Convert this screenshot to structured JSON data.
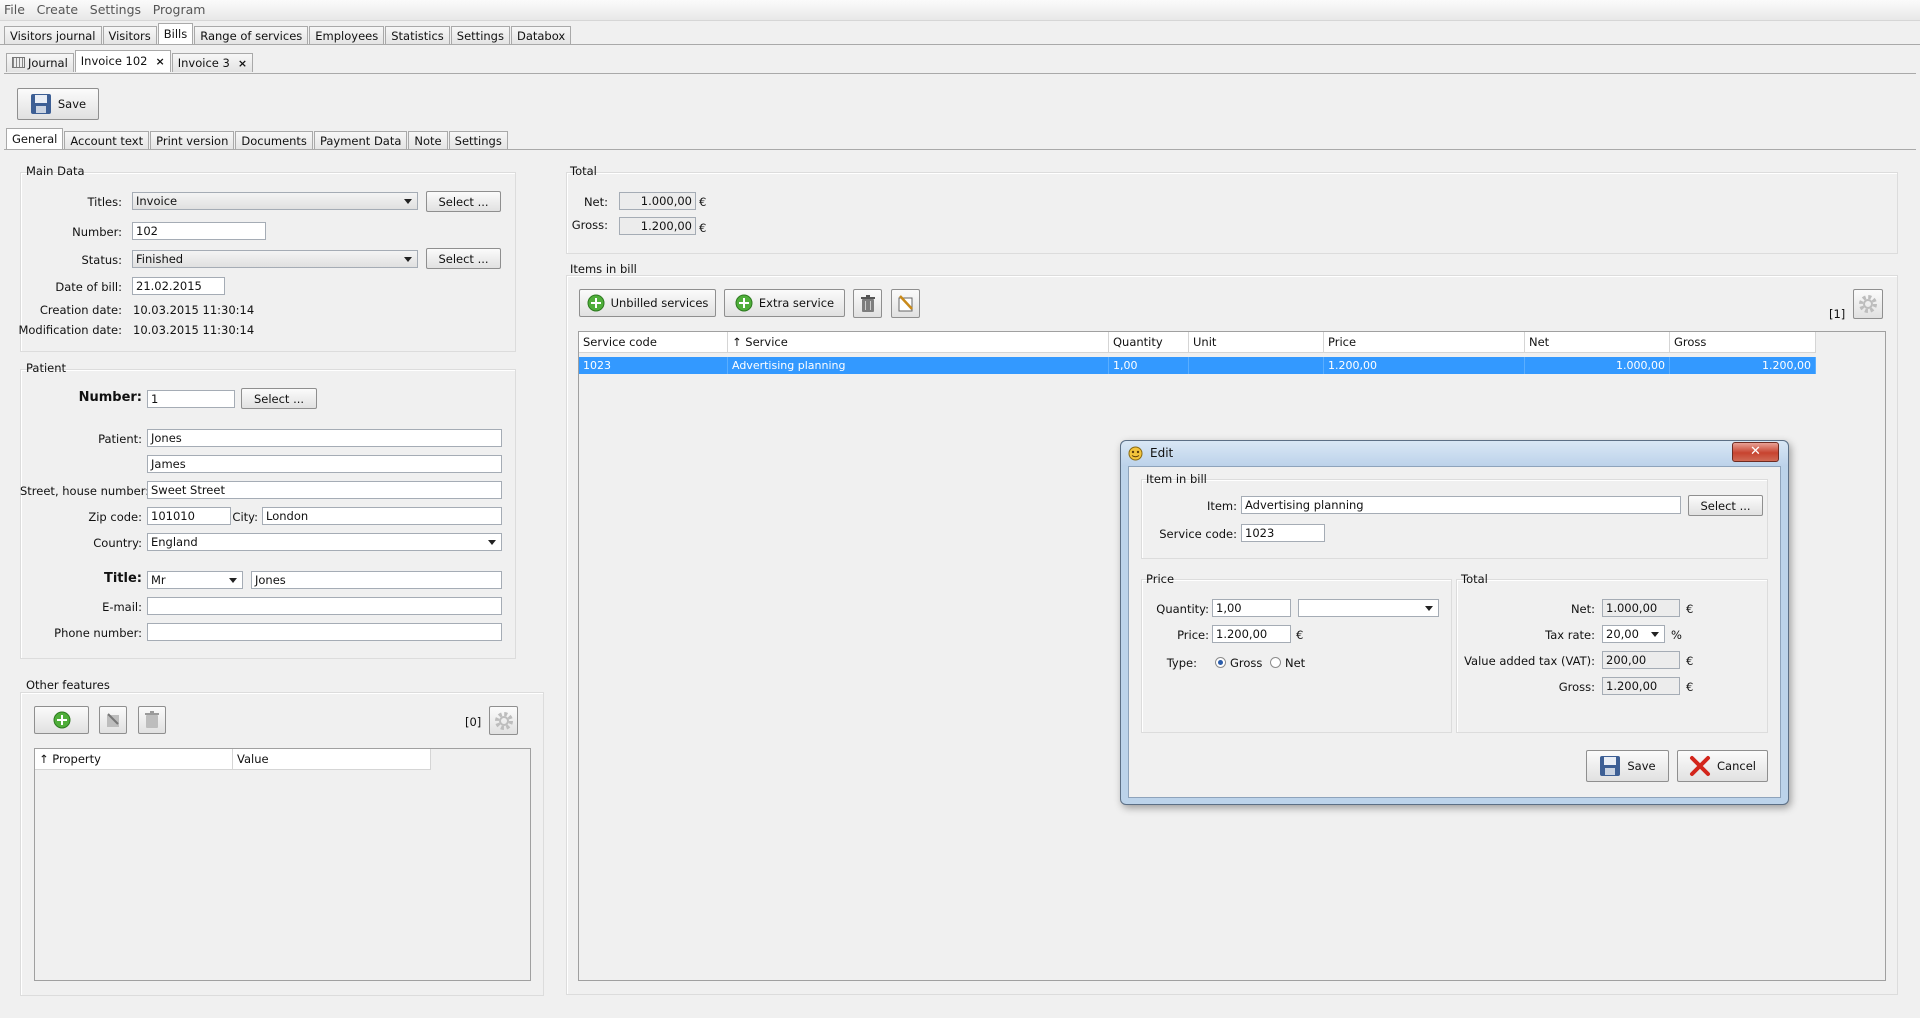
{
  "menu": [
    "File",
    "Create",
    "Settings",
    "Program"
  ],
  "main_tabs": [
    "Visitors journal",
    "Visitors",
    "Bills",
    "Range of services",
    "Employees",
    "Statistics",
    "Settings",
    "Databox"
  ],
  "doc_tabs": {
    "journal": "Journal",
    "invoice102": "Invoice 102",
    "invoice3": "Invoice 3",
    "close": "×"
  },
  "toolbar": {
    "save": "Save"
  },
  "sub_tabs": [
    "General",
    "Account text",
    "Print version",
    "Documents",
    "Payment Data",
    "Note",
    "Settings"
  ],
  "main_data": {
    "title": "Main Data",
    "titles_label": "Titles:",
    "titles_value": "Invoice",
    "select": "Select ...",
    "number_label": "Number:",
    "number_value": "102",
    "status_label": "Status:",
    "status_value": "Finished",
    "date_label": "Date of bill:",
    "date_value": "21.02.2015",
    "creation_label": "Creation date:",
    "creation_value": "10.03.2015  11:30:14",
    "modification_label": "Modification date:",
    "modification_value": "10.03.2015  11:30:14"
  },
  "patient": {
    "title": "Patient",
    "number_label": "Number:",
    "number_value": "1",
    "select": "Select ...",
    "patient_label": "Patient:",
    "last_name": "Jones",
    "first_name": "James",
    "street_label": "Street, house number:",
    "street_value": "Sweet Street",
    "zip_label": "Zip code:",
    "zip_value": "101010",
    "city_label": "City:",
    "city_value": "London",
    "country_label": "Country:",
    "country_value": "England",
    "title_label": "Title:",
    "title_value": "Mr",
    "title_name": "Jones",
    "email_label": "E-mail:",
    "email_value": "",
    "phone_label": "Phone number:",
    "phone_value": ""
  },
  "other_features": {
    "title": "Other features",
    "count": "[0]",
    "columns": [
      "↑ Property",
      "Value"
    ]
  },
  "total": {
    "title": "Total",
    "net_label": "Net:",
    "net_value": "1.000,00",
    "gross_label": "Gross:",
    "gross_value": "1.200,00",
    "currency": "€"
  },
  "items": {
    "title": "Items in bill",
    "unbilled": "Unbilled services",
    "extra": "Extra service",
    "count": "[1]",
    "columns": [
      "Service code",
      "↑ Service",
      "Quantity",
      "Unit",
      "Price",
      "Net",
      "Gross"
    ],
    "row": [
      "1023",
      "Advertising planning",
      "1,00",
      "",
      "1.200,00",
      "1.000,00",
      "1.200,00"
    ]
  },
  "dialog": {
    "title": "Edit",
    "close": "✕",
    "item_group": "Item in bill",
    "item_label": "Item:",
    "item_value": "Advertising planning",
    "select": "Select ...",
    "code_label": "Service code:",
    "code_value": "1023",
    "price_group": "Price",
    "qty_label": "Quantity:",
    "qty_value": "1,00",
    "unit_value": "",
    "price_label": "Price:",
    "price_value": "1.200,00",
    "currency": "€",
    "type_label": "Type:",
    "type_gross": "Gross",
    "type_net": "Net",
    "total_group": "Total",
    "net_label": "Net:",
    "net_value": "1.000,00",
    "tax_label": "Tax rate:",
    "tax_value": "20,00",
    "percent": "%",
    "vat_label": "Value added tax (VAT):",
    "vat_value": "200,00",
    "gross_label": "Gross:",
    "gross_value": "1.200,00",
    "save": "Save",
    "cancel": "Cancel"
  }
}
